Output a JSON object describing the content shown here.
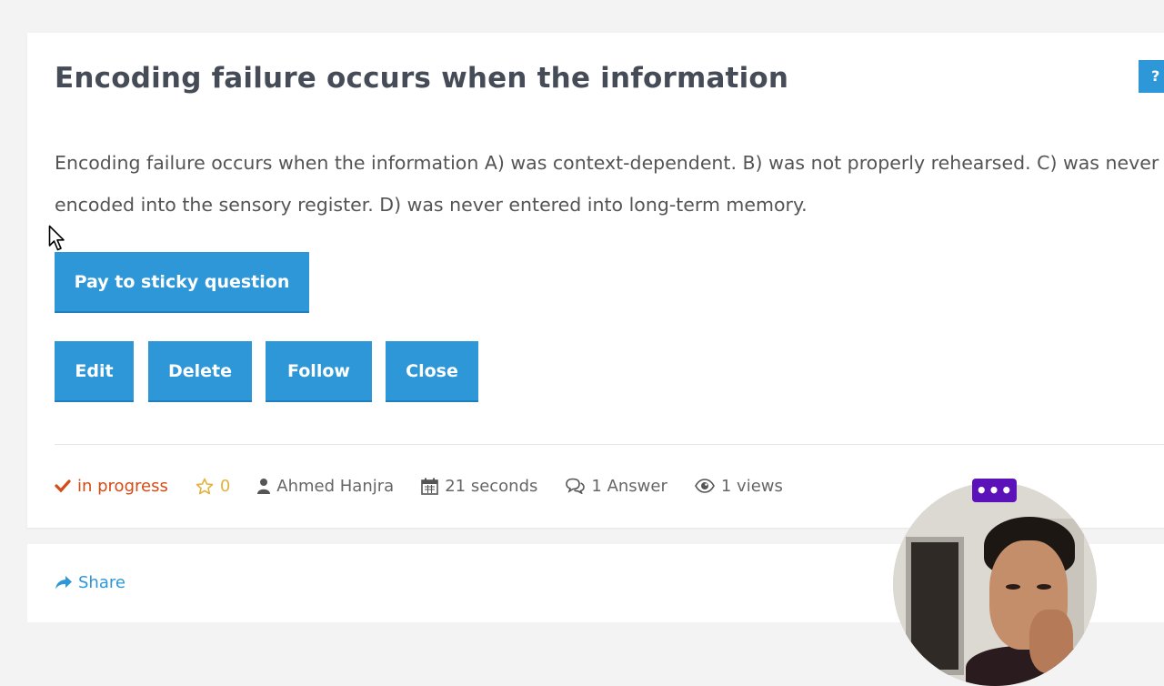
{
  "question": {
    "title": "Encoding failure occurs when the information",
    "body": "Encoding failure occurs when the information A) was context-dependent. B) was not properly rehearsed. C) was never encoded into the sensory register. D) was never entered into long-term memory.",
    "help_label": "?"
  },
  "actions": {
    "sticky_label": "Pay to sticky question",
    "edit_label": "Edit",
    "delete_label": "Delete",
    "follow_label": "Follow",
    "close_label": "Close"
  },
  "meta": {
    "status": "in progress",
    "votes": "0",
    "author": "Ahmed Hanjra",
    "time": "21 seconds",
    "answers": "1 Answer",
    "views": "1 views"
  },
  "share": {
    "label": "Share"
  },
  "overlay": {
    "menu_label": "•••"
  },
  "colors": {
    "primary": "#2e97d8",
    "status": "#d34b16",
    "star": "#e3b23c",
    "menu": "#5b12b8"
  }
}
